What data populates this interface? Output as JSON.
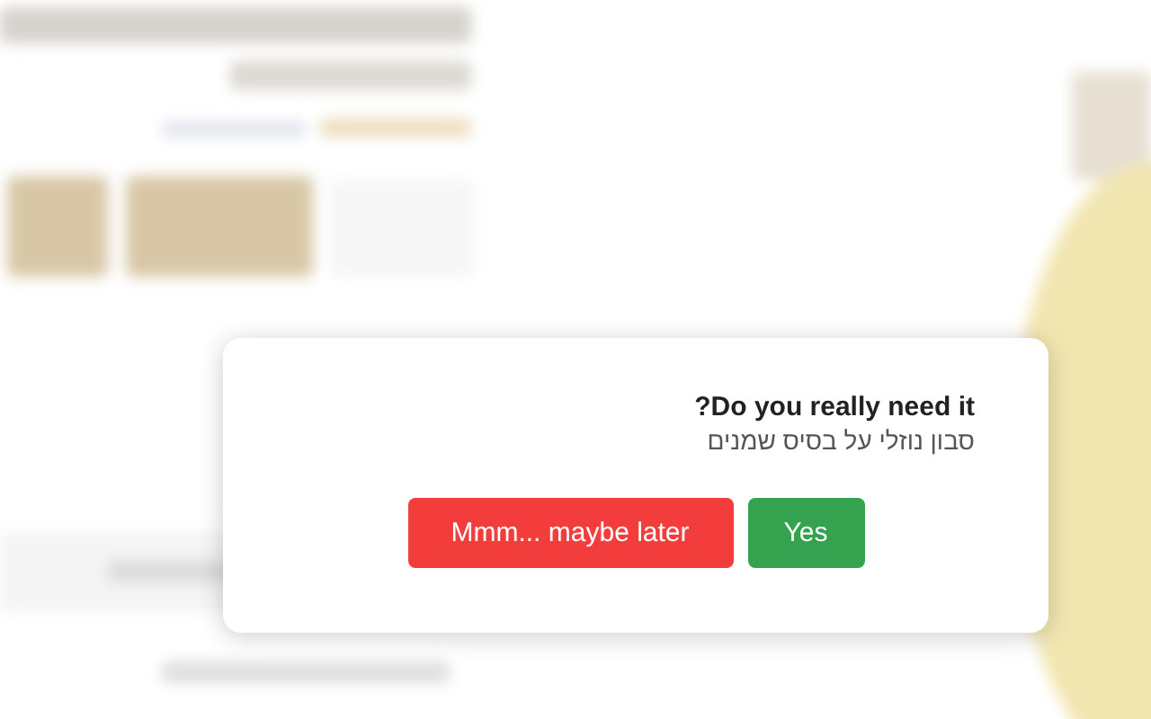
{
  "dialog": {
    "title": "Do you really need it?",
    "subtitle": "סבון נוזלי על בסיס שמנים",
    "buttons": [
      {
        "label": "Mmm... maybe later",
        "kind": "cancel"
      },
      {
        "label": "Yes",
        "kind": "confirm"
      }
    ]
  }
}
